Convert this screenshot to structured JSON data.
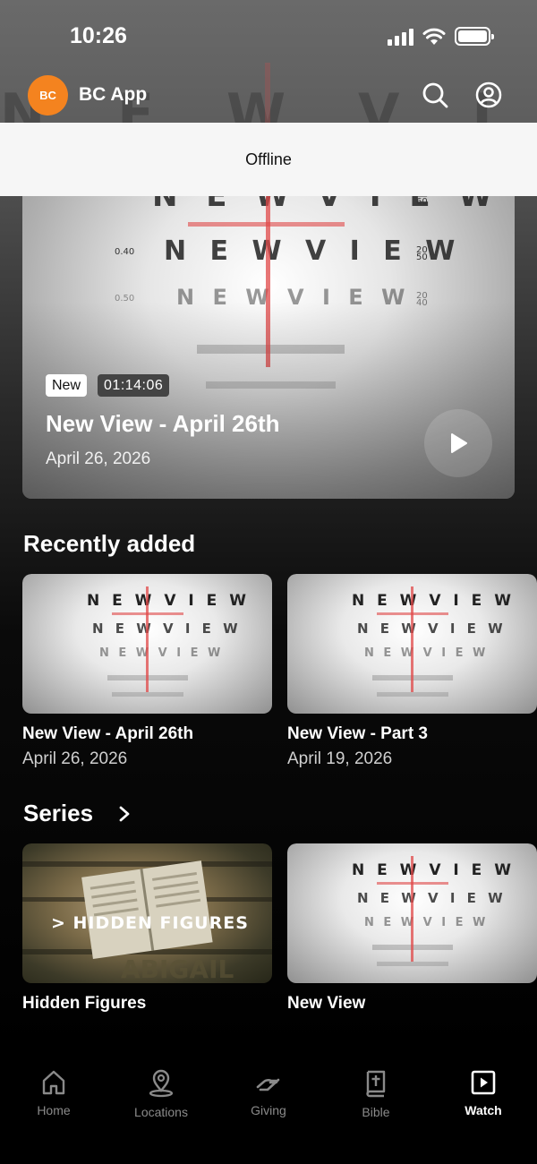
{
  "status_bar": {
    "time": "10:26"
  },
  "header": {
    "avatar_initials": "BC",
    "app_title": "BC App"
  },
  "offline_banner": {
    "text": "Offline"
  },
  "hero": {
    "tag_new": "New",
    "duration": "01:14:06",
    "title": "New View - April 26th",
    "date": "April 26, 2026",
    "chart_words": "NEW VIEW"
  },
  "recently_added": {
    "title": "Recently added",
    "items": [
      {
        "title": "New View - April 26th",
        "date": "April 26, 2026"
      },
      {
        "title": "New View - Part 3",
        "date": "April 19, 2026"
      }
    ]
  },
  "series": {
    "title": "Series",
    "items": [
      {
        "title": "Hidden Figures",
        "art_text": "> HIDDEN FIGURES"
      },
      {
        "title": "New View"
      }
    ]
  },
  "tabs": [
    {
      "label": "Home",
      "icon": "home-icon"
    },
    {
      "label": "Locations",
      "icon": "location-pin-icon"
    },
    {
      "label": "Giving",
      "icon": "giving-hand-icon"
    },
    {
      "label": "Bible",
      "icon": "bible-icon"
    },
    {
      "label": "Watch",
      "icon": "play-square-icon",
      "active": true
    }
  ],
  "colors": {
    "avatar": "#f4831f",
    "cross": "#e04848",
    "offline_bg": "#f6f6f6"
  }
}
